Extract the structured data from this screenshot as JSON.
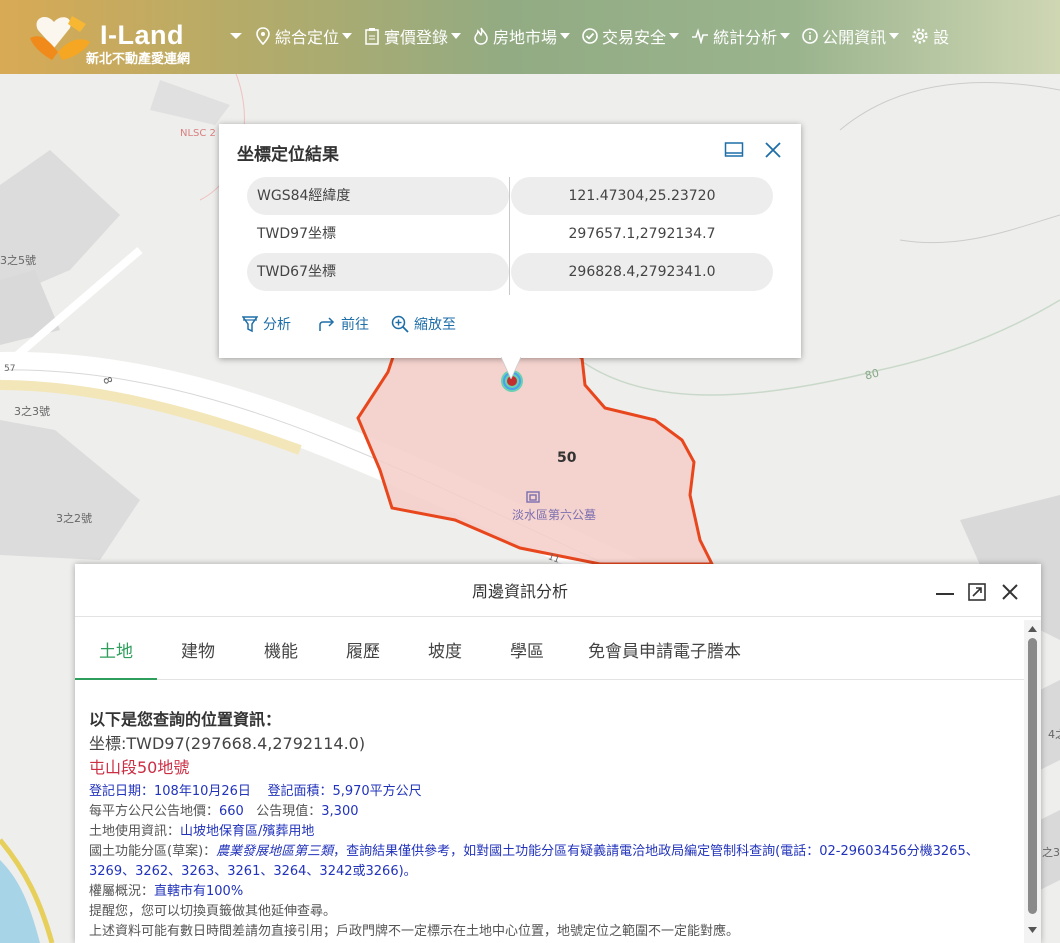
{
  "header": {
    "logo_title": "I-Land",
    "logo_subtitle": "新北不動產愛連網",
    "nav": [
      {
        "label": "綜合定位"
      },
      {
        "label": "實價登錄"
      },
      {
        "label": "房地市場"
      },
      {
        "label": "交易安全"
      },
      {
        "label": "統計分析"
      },
      {
        "label": "公開資訊"
      },
      {
        "label": "設"
      }
    ]
  },
  "map": {
    "labels": [
      "NLSC 2",
      "8",
      "3之5號",
      "57",
      "8",
      "3之3號",
      "80",
      "3之2號",
      "50",
      "淡水區第六公墓",
      "4之",
      "之3",
      "11"
    ]
  },
  "coord_popup": {
    "title": "坐標定位結果",
    "rows": [
      {
        "label": "WGS84經緯度",
        "value": "121.47304,25.23720"
      },
      {
        "label": "TWD97坐標",
        "value": "297657.1,2792134.7"
      },
      {
        "label": "TWD67坐標",
        "value": "296828.4,2792341.0"
      }
    ],
    "actions": {
      "analyze": "分析",
      "goto": "前往",
      "zoom": "縮放至"
    }
  },
  "info_panel": {
    "title": "周邊資訊分析",
    "tabs": [
      "土地",
      "建物",
      "機能",
      "履歷",
      "坡度",
      "學區",
      "免會員申請電子謄本"
    ],
    "active_tab": "土地",
    "content": {
      "heading": "以下是您查詢的位置資訊：",
      "coordinate": "坐標:TWD97(297668.4,2792114.0)",
      "parcel": "屯山段50地號",
      "reg_date_label": "登記日期：",
      "reg_date": "108年10月26日",
      "reg_area_label": "登記面積：",
      "reg_area": "5,970平方公尺",
      "land_price_label": "每平方公尺公告地價：",
      "land_price": "660",
      "present_value_label": "公告現值：",
      "present_value": "3,300",
      "land_use_label": "土地使用資訊：",
      "land_use": "山坡地保育區/殯葬用地",
      "zoning_label": "國土功能分區(草案)：",
      "zoning_class": "農業發展地區第三類",
      "zoning_note": "，查詢結果僅供參考，如對國土功能分區有疑義請電洽地政局編定管制科查詢(電話：02-29603456分機3265、3269、3262、3263、3261、3264、3242或3266)。",
      "ownership_label": "權屬概況：",
      "ownership": "直轄市有100%",
      "reminder": "提醒您，您可以切換頁籤做其他延伸查尋。",
      "disclaimer": "上述資料可能有數日時間差請勿直接引用；戶政門牌不一定標示在土地中心位置，地號定位之範圍不一定能對應。"
    }
  },
  "colors": {
    "parcel_border": "#e8471e",
    "parcel_fill": "#f4cdc8",
    "link_blue": "#1e6ea8",
    "tab_active": "#2e9e5c",
    "parcel_red": "#cc2e44",
    "info_blue": "#2233bb"
  }
}
